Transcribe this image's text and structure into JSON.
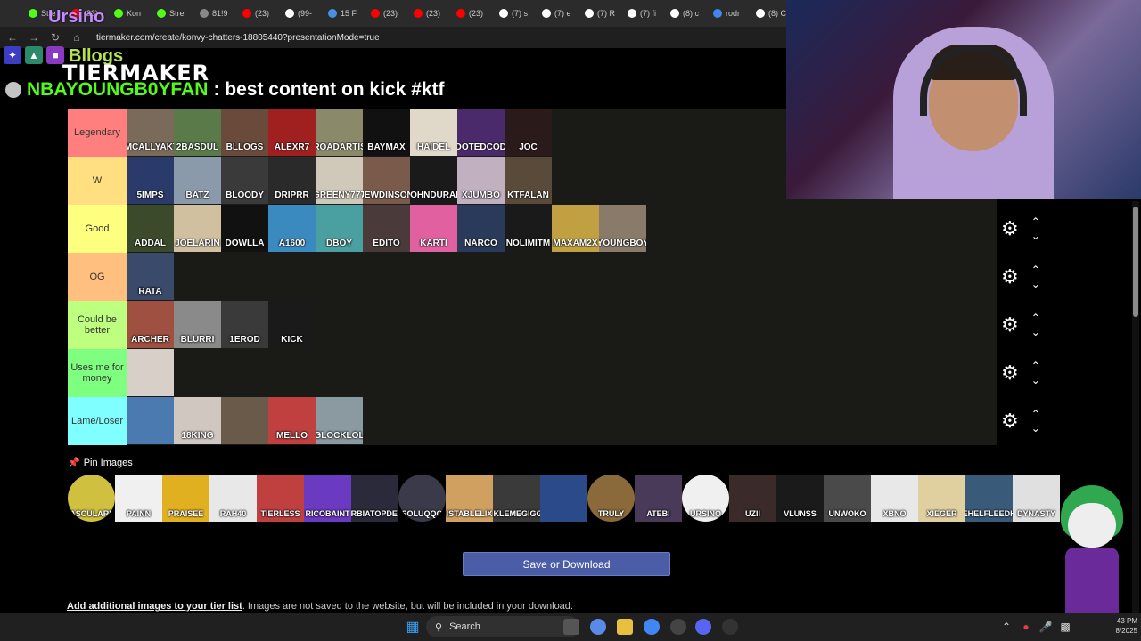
{
  "browser": {
    "tabs": [
      {
        "label": "Stre",
        "color": "#53fc18"
      },
      {
        "label": "(23)",
        "color": "#ff0000"
      },
      {
        "label": "Kon",
        "color": "#53fc18"
      },
      {
        "label": "Stre",
        "color": "#53fc18"
      },
      {
        "label": "81!9",
        "color": "#888"
      },
      {
        "label": "(23)",
        "color": "#ff0000"
      },
      {
        "label": "(99-",
        "color": "#fff"
      },
      {
        "label": "15 F",
        "color": "#4a90e2"
      },
      {
        "label": "(23)",
        "color": "#ff0000"
      },
      {
        "label": "(23)",
        "color": "#ff0000"
      },
      {
        "label": "(23)",
        "color": "#ff0000"
      },
      {
        "label": "(7) s",
        "color": "#fff"
      },
      {
        "label": "(7) e",
        "color": "#fff"
      },
      {
        "label": "(7) R",
        "color": "#fff"
      },
      {
        "label": "(7) fi",
        "color": "#fff"
      },
      {
        "label": "(8) c",
        "color": "#fff"
      },
      {
        "label": "rodr",
        "color": "#4285f4"
      },
      {
        "label": "(8) C",
        "color": "#fff"
      }
    ],
    "url": "tiermaker.com/create/konvy-chatters-18805440?presentationMode=true"
  },
  "overlay": {
    "channel_name": "Ursino",
    "blogs_text": "Bllogs",
    "chat_user": "NBAYOUNGB0YFAN",
    "chat_message": ": best content on kick #ktf"
  },
  "brand": "TIERMAKER",
  "tiers": [
    {
      "label": "Legendary",
      "color": "#ff7f7f",
      "items": [
        {
          "name": "IMCALLYAKT",
          "bg": "#7a6a5a"
        },
        {
          "name": "2BASDUL",
          "bg": "#5a7a4a"
        },
        {
          "name": "BLLOGS",
          "bg": "#6a4a3a"
        },
        {
          "name": "ALEXR7",
          "bg": "#a02020"
        },
        {
          "name": "BROADARTIST",
          "bg": "#8a8a6a"
        },
        {
          "name": "BAYMAX",
          "bg": "#111111"
        },
        {
          "name": "HAIDEL",
          "bg": "#e0d8c8"
        },
        {
          "name": "ZOOTEDCODA",
          "bg": "#4a2a6a"
        },
        {
          "name": "JOC",
          "bg": "#2a1a1a"
        }
      ]
    },
    {
      "label": "W",
      "color": "#ffdf7f",
      "items": [
        {
          "name": "5IMPS",
          "bg": "#2a3a6a"
        },
        {
          "name": "BATZ",
          "bg": "#8a9aaa"
        },
        {
          "name": "BLOODY",
          "bg": "#3a3a3a"
        },
        {
          "name": "DRIPRR",
          "bg": "#2a2a2a"
        },
        {
          "name": "GREENY777",
          "bg": "#d0c8b8"
        },
        {
          "name": "JEWDINSON",
          "bg": "#7a5a4a"
        },
        {
          "name": "JOHNDURAN",
          "bg": "#1a1a1a"
        },
        {
          "name": "XJUMBO",
          "bg": "#c0b0c0"
        },
        {
          "name": "KTFALAN",
          "bg": "#5a4a3a"
        }
      ]
    },
    {
      "label": "Good",
      "color": "#ffff7f",
      "items": [
        {
          "name": "ADDAL",
          "bg": "#3a4a2a"
        },
        {
          "name": "JOELARIN",
          "bg": "#d0c0a0"
        },
        {
          "name": "DOWLLA",
          "bg": "#111111"
        },
        {
          "name": "A1600",
          "bg": "#3a8ac0"
        },
        {
          "name": "DBOY",
          "bg": "#4aa0a0"
        },
        {
          "name": "EDITO",
          "bg": "#4a3a3a"
        },
        {
          "name": "KARTI",
          "bg": "#e060a0"
        },
        {
          "name": "NARCO",
          "bg": "#2a3a5a"
        },
        {
          "name": "NOLIMITM",
          "bg": "#1a1a1a"
        },
        {
          "name": "MAXAM2X",
          "bg": "#c0a040"
        },
        {
          "name": "NBAYOUNGBOYFAN",
          "bg": "#8a7a6a"
        }
      ]
    },
    {
      "label": "OG",
      "color": "#ffbf7f",
      "items": [
        {
          "name": "RATA",
          "bg": "#3a4a6a"
        }
      ]
    },
    {
      "label": "Could be better",
      "color": "#bfff7f",
      "items": [
        {
          "name": "ARCHER",
          "bg": "#a05040"
        },
        {
          "name": "BLURRI",
          "bg": "#8a8a8a"
        },
        {
          "name": "1EROD",
          "bg": "#3a3a3a"
        },
        {
          "name": "KICK",
          "bg": "#1a1a1a"
        }
      ]
    },
    {
      "label": "Uses me for money",
      "color": "#7fff7f",
      "items": [
        {
          "name": "",
          "bg": "#d8d0c8"
        }
      ]
    },
    {
      "label": "Lame/Loser",
      "color": "#7fffff",
      "items": [
        {
          "name": "",
          "bg": "#4a7ab0"
        },
        {
          "name": "18KING",
          "bg": "#d0c8c0"
        },
        {
          "name": "",
          "bg": "#6a5a4a"
        },
        {
          "name": "MELLO",
          "bg": "#c04040"
        },
        {
          "name": "GLOCKLOL",
          "bg": "#8a9aa0"
        }
      ]
    }
  ],
  "pin": {
    "heading": "Pin Images",
    "items": [
      {
        "name": "OBASCULARFAN",
        "bg": "#d0c040"
      },
      {
        "name": "PAINN",
        "bg": "#f0f0f0"
      },
      {
        "name": "PRAISEE",
        "bg": "#e0b020"
      },
      {
        "name": "RAH40",
        "bg": "#e8e8e8"
      },
      {
        "name": "TIERLESS",
        "bg": "#c04040"
      },
      {
        "name": "RICOBAINT",
        "bg": "#6a3ac0"
      },
      {
        "name": "ERBIATOPDEM",
        "bg": "#2a2a3a"
      },
      {
        "name": "SOLUQQQ",
        "bg": "#3a3a4a"
      },
      {
        "name": "ISTABLELIX",
        "bg": "#d0a060"
      },
      {
        "name": "TICKLEMEGIGGLE",
        "bg": "#3a3a3a"
      },
      {
        "name": "",
        "bg": "#2a4a8a"
      },
      {
        "name": "TRULY",
        "bg": "#8a6a3a"
      },
      {
        "name": "ATEBI",
        "bg": "#4a3a5a"
      },
      {
        "name": "URSINO",
        "bg": "#f0f0f0"
      },
      {
        "name": "UZII",
        "bg": "#3a2a2a"
      },
      {
        "name": "VLUNSS",
        "bg": "#1a1a1a"
      },
      {
        "name": "UNWOKO",
        "bg": "#4a4a4a"
      },
      {
        "name": "XBNO",
        "bg": "#e8e8e8"
      },
      {
        "name": "XIEGER",
        "bg": "#e0d0a0"
      },
      {
        "name": "ZAEHELFLEEDHAY",
        "bg": "#3a5a7a"
      },
      {
        "name": "DYNASTY",
        "bg": "#e0e0e0"
      }
    ]
  },
  "save_label": "Save or Download",
  "add_info_bold": "Add additional images to your tier list",
  "add_info_rest": ". Images are not saved to the website, but will be included in your download.",
  "taskbar": {
    "search_placeholder": "Search",
    "time": "43 PM",
    "date": "8/2025"
  }
}
